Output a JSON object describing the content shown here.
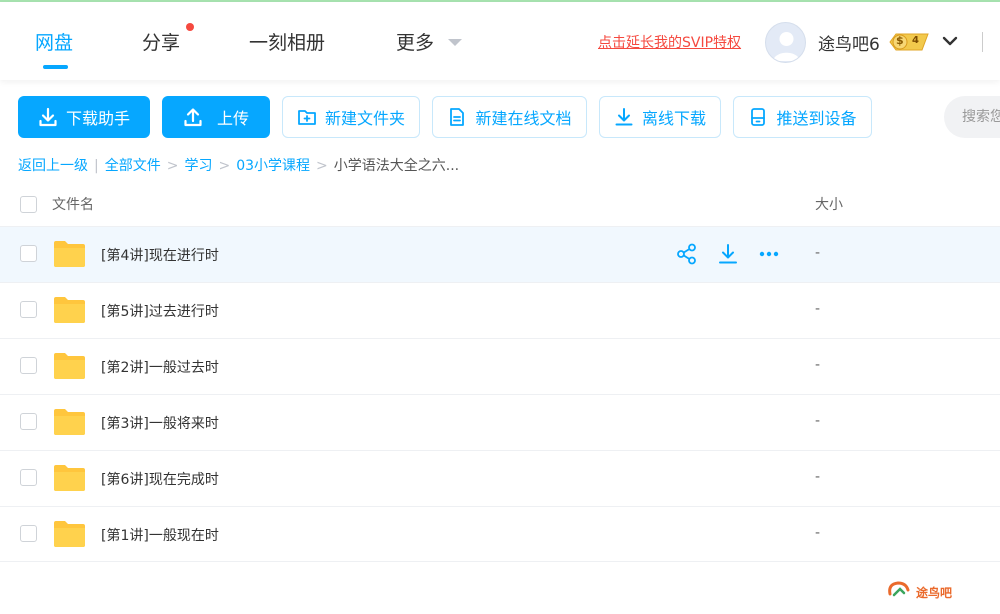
{
  "nav": {
    "tabs": [
      {
        "label": "网盘",
        "active": true
      },
      {
        "label": "分享",
        "has_dot": true
      },
      {
        "label": "一刻相册"
      },
      {
        "label": "更多"
      }
    ],
    "promo_link": "点击延长我的SVIP特权",
    "username": "途鸟吧6",
    "badge": {
      "prefix": "$",
      "level": "4"
    }
  },
  "toolbar": {
    "download_helper": "下载助手",
    "upload": "上传",
    "new_folder": "新建文件夹",
    "new_online_doc": "新建在线文档",
    "offline_download": "离线下载",
    "push_to_device": "推送到设备",
    "search_placeholder": "搜索您"
  },
  "breadcrumb": {
    "back": "返回上一级",
    "items": [
      "全部文件",
      "学习",
      "03小学课程"
    ],
    "current": "小学语法大全之六..."
  },
  "table": {
    "col_name": "文件名",
    "col_size": "大小",
    "rows": [
      {
        "name": "[第4讲]现在进行时",
        "size": "-"
      },
      {
        "name": "[第5讲]过去进行时",
        "size": "-"
      },
      {
        "name": "[第2讲]一般过去时",
        "size": "-"
      },
      {
        "name": "[第3讲]一般将来时",
        "size": "-"
      },
      {
        "name": "[第6讲]现在完成时",
        "size": "-"
      },
      {
        "name": "[第1讲]一般现在时",
        "size": "-"
      }
    ]
  },
  "watermark": "途鸟吧",
  "colors": {
    "accent": "#06a7ff",
    "promo": "#f5493f",
    "folder": "#ffc63d",
    "hover_row": "#f1f8fe"
  }
}
